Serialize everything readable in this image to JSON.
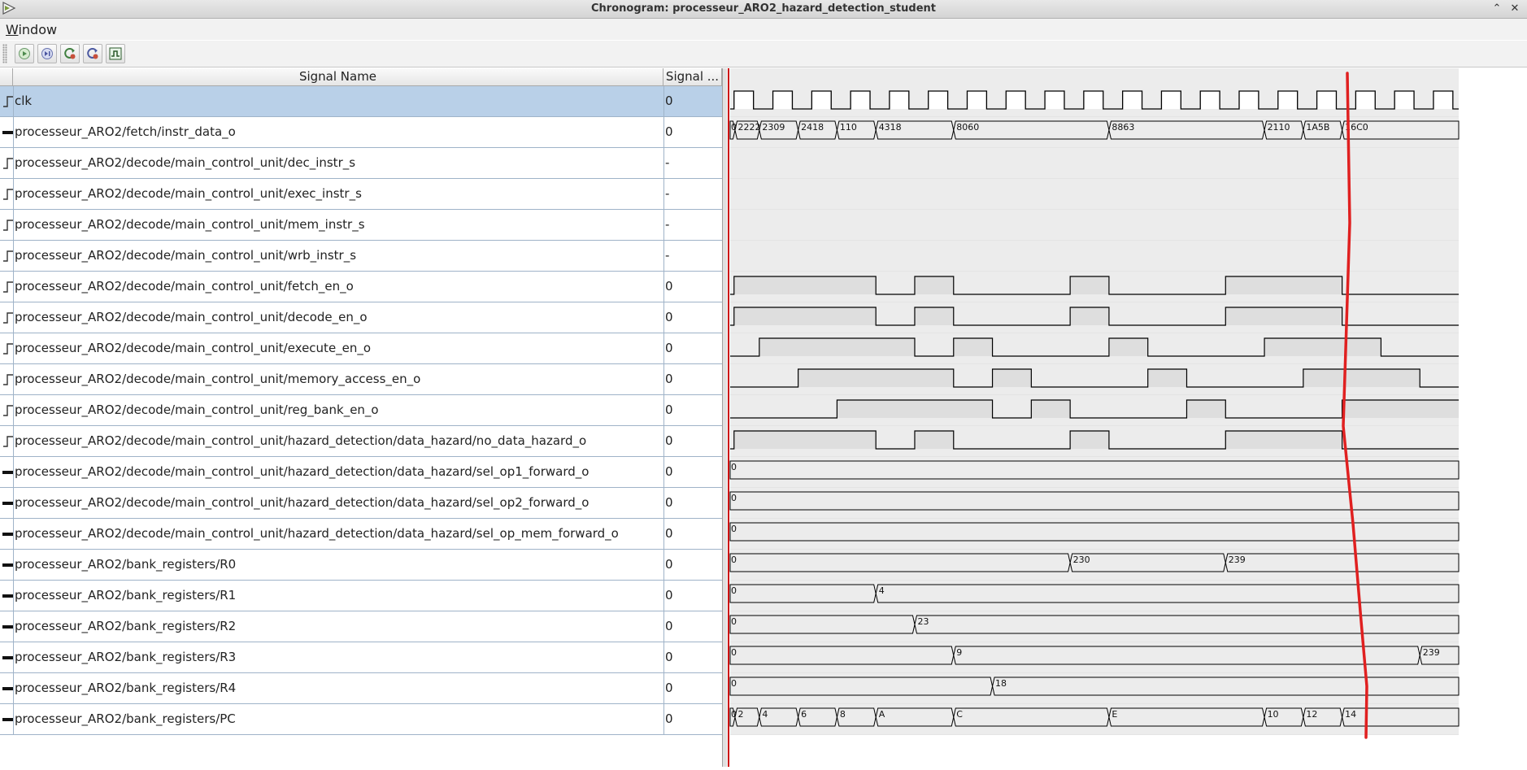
{
  "window": {
    "title": "Chronogram: processeur_ARO2_hazard_detection_student",
    "controls": [
      "minimize-icon",
      "close-icon"
    ]
  },
  "menubar": {
    "items": [
      "Window"
    ]
  },
  "toolbar": {
    "buttons": [
      {
        "name": "run-button",
        "icon": "play-circle-icon"
      },
      {
        "name": "step-button",
        "icon": "step-circle-icon"
      },
      {
        "name": "reset-button",
        "icon": "refresh-icon"
      },
      {
        "name": "reset-all-button",
        "icon": "refresh-double-icon"
      },
      {
        "name": "zoom-fit-button",
        "icon": "square-wave-icon"
      }
    ]
  },
  "table": {
    "columns": [
      "Signal Name",
      "Signal ..."
    ],
    "selected_row": 0,
    "signals": [
      {
        "name": "clk",
        "value": "0",
        "kind": "bit"
      },
      {
        "name": "processeur_ARO2/fetch/instr_data_o",
        "value": "0",
        "kind": "bus"
      },
      {
        "name": "processeur_ARO2/decode/main_control_unit/dec_instr_s",
        "value": "-",
        "kind": "bit"
      },
      {
        "name": "processeur_ARO2/decode/main_control_unit/exec_instr_s",
        "value": "-",
        "kind": "bit"
      },
      {
        "name": "processeur_ARO2/decode/main_control_unit/mem_instr_s",
        "value": "-",
        "kind": "bit"
      },
      {
        "name": "processeur_ARO2/decode/main_control_unit/wrb_instr_s",
        "value": "-",
        "kind": "bit"
      },
      {
        "name": "processeur_ARO2/decode/main_control_unit/fetch_en_o",
        "value": "0",
        "kind": "bit"
      },
      {
        "name": "processeur_ARO2/decode/main_control_unit/decode_en_o",
        "value": "0",
        "kind": "bit"
      },
      {
        "name": "processeur_ARO2/decode/main_control_unit/execute_en_o",
        "value": "0",
        "kind": "bit"
      },
      {
        "name": "processeur_ARO2/decode/main_control_unit/memory_access_en_o",
        "value": "0",
        "kind": "bit"
      },
      {
        "name": "processeur_ARO2/decode/main_control_unit/reg_bank_en_o",
        "value": "0",
        "kind": "bit"
      },
      {
        "name": "processeur_ARO2/decode/main_control_unit/hazard_detection/data_hazard/no_data_hazard_o",
        "value": "0",
        "kind": "bit"
      },
      {
        "name": "processeur_ARO2/decode/main_control_unit/hazard_detection/data_hazard/sel_op1_forward_o",
        "value": "0",
        "kind": "bus"
      },
      {
        "name": "processeur_ARO2/decode/main_control_unit/hazard_detection/data_hazard/sel_op2_forward_o",
        "value": "0",
        "kind": "bus"
      },
      {
        "name": "processeur_ARO2/decode/main_control_unit/hazard_detection/data_hazard/sel_op_mem_forward_o",
        "value": "0",
        "kind": "bus"
      },
      {
        "name": "processeur_ARO2/bank_registers/R0",
        "value": "0",
        "kind": "bus"
      },
      {
        "name": "processeur_ARO2/bank_registers/R1",
        "value": "0",
        "kind": "bus"
      },
      {
        "name": "processeur_ARO2/bank_registers/R2",
        "value": "0",
        "kind": "bus"
      },
      {
        "name": "processeur_ARO2/bank_registers/R3",
        "value": "0",
        "kind": "bus"
      },
      {
        "name": "processeur_ARO2/bank_registers/R4",
        "value": "0",
        "kind": "bus"
      },
      {
        "name": "processeur_ARO2/bank_registers/PC",
        "value": "0",
        "kind": "bus"
      }
    ]
  },
  "waveforms": {
    "time_units_visible": 37.5,
    "clock_period_units": 2,
    "annotation_color": "#e02020",
    "highlight_color": "#dedede",
    "cursor_color": "#cc0000",
    "rows": [
      {
        "type": "clock"
      },
      {
        "type": "bus",
        "segments": [
          {
            "t": 0,
            "label": "0"
          },
          {
            "t": 0.25,
            "label": "2222"
          },
          {
            "t": 1.5,
            "label": "2309"
          },
          {
            "t": 3.5,
            "label": "2418"
          },
          {
            "t": 5.5,
            "label": "110"
          },
          {
            "t": 7.5,
            "label": "4318"
          },
          {
            "t": 11.5,
            "label": "8060"
          },
          {
            "t": 19.5,
            "label": "8863"
          },
          {
            "t": 27.5,
            "label": "2110"
          },
          {
            "t": 29.5,
            "label": "1A5B"
          },
          {
            "t": 31.5,
            "label": "16C0"
          }
        ]
      },
      {
        "type": "empty"
      },
      {
        "type": "empty"
      },
      {
        "type": "empty"
      },
      {
        "type": "empty"
      },
      {
        "type": "bit",
        "high": [
          [
            0.2,
            7.5
          ],
          [
            9.5,
            11.5
          ],
          [
            17.5,
            19.5
          ],
          [
            25.5,
            31.5
          ]
        ]
      },
      {
        "type": "bit",
        "high": [
          [
            0.2,
            7.5
          ],
          [
            9.5,
            11.5
          ],
          [
            17.5,
            19.5
          ],
          [
            25.5,
            31.5
          ]
        ]
      },
      {
        "type": "bit",
        "high": [
          [
            1.5,
            9.5
          ],
          [
            11.5,
            13.5
          ],
          [
            19.5,
            21.5
          ],
          [
            27.5,
            33.5
          ]
        ]
      },
      {
        "type": "bit",
        "high": [
          [
            3.5,
            11.5
          ],
          [
            13.5,
            15.5
          ],
          [
            21.5,
            23.5
          ],
          [
            29.5,
            35.5
          ]
        ]
      },
      {
        "type": "bit",
        "high": [
          [
            5.5,
            13.5
          ],
          [
            15.5,
            17.5
          ],
          [
            23.5,
            25.5
          ],
          [
            31.5,
            37.5
          ]
        ]
      },
      {
        "type": "bit",
        "high": [
          [
            0.2,
            7.5
          ],
          [
            9.5,
            11.5
          ],
          [
            17.5,
            19.5
          ],
          [
            25.5,
            31.5
          ]
        ]
      },
      {
        "type": "bus",
        "segments": [
          {
            "t": 0,
            "label": "0"
          }
        ]
      },
      {
        "type": "bus",
        "segments": [
          {
            "t": 0,
            "label": "0"
          }
        ]
      },
      {
        "type": "bus",
        "segments": [
          {
            "t": 0,
            "label": "0"
          }
        ]
      },
      {
        "type": "bus",
        "segments": [
          {
            "t": 0,
            "label": "0"
          },
          {
            "t": 17.5,
            "label": "230"
          },
          {
            "t": 25.5,
            "label": "239"
          }
        ]
      },
      {
        "type": "bus",
        "segments": [
          {
            "t": 0,
            "label": "0"
          },
          {
            "t": 7.5,
            "label": "4"
          }
        ]
      },
      {
        "type": "bus",
        "segments": [
          {
            "t": 0,
            "label": "0"
          },
          {
            "t": 9.5,
            "label": "23"
          }
        ]
      },
      {
        "type": "bus",
        "segments": [
          {
            "t": 0,
            "label": "0"
          },
          {
            "t": 11.5,
            "label": "9"
          },
          {
            "t": 35.5,
            "label": "239"
          }
        ]
      },
      {
        "type": "bus",
        "segments": [
          {
            "t": 0,
            "label": "0"
          },
          {
            "t": 13.5,
            "label": "18"
          }
        ]
      },
      {
        "type": "bus",
        "segments": [
          {
            "t": 0,
            "label": "0"
          },
          {
            "t": 0.25,
            "label": "2"
          },
          {
            "t": 1.5,
            "label": "4"
          },
          {
            "t": 3.5,
            "label": "6"
          },
          {
            "t": 5.5,
            "label": "8"
          },
          {
            "t": 7.5,
            "label": "A"
          },
          {
            "t": 11.5,
            "label": "C"
          },
          {
            "t": 19.5,
            "label": "E"
          },
          {
            "t": 27.5,
            "label": "10"
          },
          {
            "t": 29.5,
            "label": "12"
          },
          {
            "t": 31.5,
            "label": "14"
          }
        ]
      }
    ]
  }
}
